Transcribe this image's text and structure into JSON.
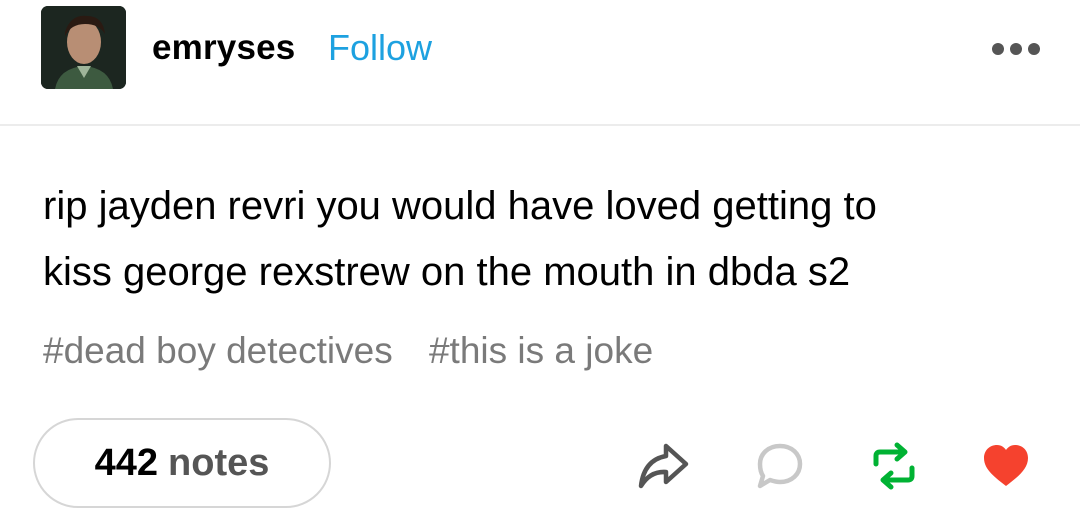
{
  "post": {
    "author": "emryses",
    "follow_label": "Follow",
    "body_lines": [
      "rip jayden revri you would have loved getting to",
      "kiss george rexstrew on the mouth in dbda s2"
    ],
    "tags": [
      "#dead boy detectives",
      "#this is a joke"
    ],
    "notes_count": "442",
    "notes_label": "notes"
  },
  "colors": {
    "follow": "#1da1e0",
    "reblog": "#00b233",
    "like": "#f5422e",
    "icon_gray": "#555555",
    "reply_gray": "#c8c8c8"
  },
  "icons": {
    "more": "more-dots-icon",
    "share": "share-arrow-icon",
    "reply": "reply-bubble-icon",
    "reblog": "reblog-icon",
    "like": "heart-icon"
  }
}
